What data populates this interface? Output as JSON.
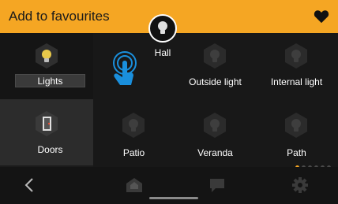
{
  "header": {
    "title": "Add to favourites",
    "heart_icon": "heart-icon"
  },
  "sidebar": [
    {
      "label": "Lights",
      "icon": "bulb-icon",
      "selected": true
    },
    {
      "label": "Doors",
      "icon": "door-icon",
      "selected": false
    }
  ],
  "popup": {
    "label": "Hall",
    "icon": "bulb-icon"
  },
  "tiles": [
    {
      "label": "Outside light"
    },
    {
      "label": "Internal light"
    },
    {
      "label": "Patio"
    },
    {
      "label": "Veranda"
    },
    {
      "label": "Path"
    }
  ],
  "pager": {
    "pages": 6,
    "current": 1
  },
  "nav": {
    "back": "back-icon",
    "home": "home-icon",
    "messages": "chat-icon",
    "settings": "gear-icon"
  },
  "colors": {
    "accent": "#f5a623",
    "background": "#1f1f1f",
    "tap_hint": "#1a8fdc"
  }
}
